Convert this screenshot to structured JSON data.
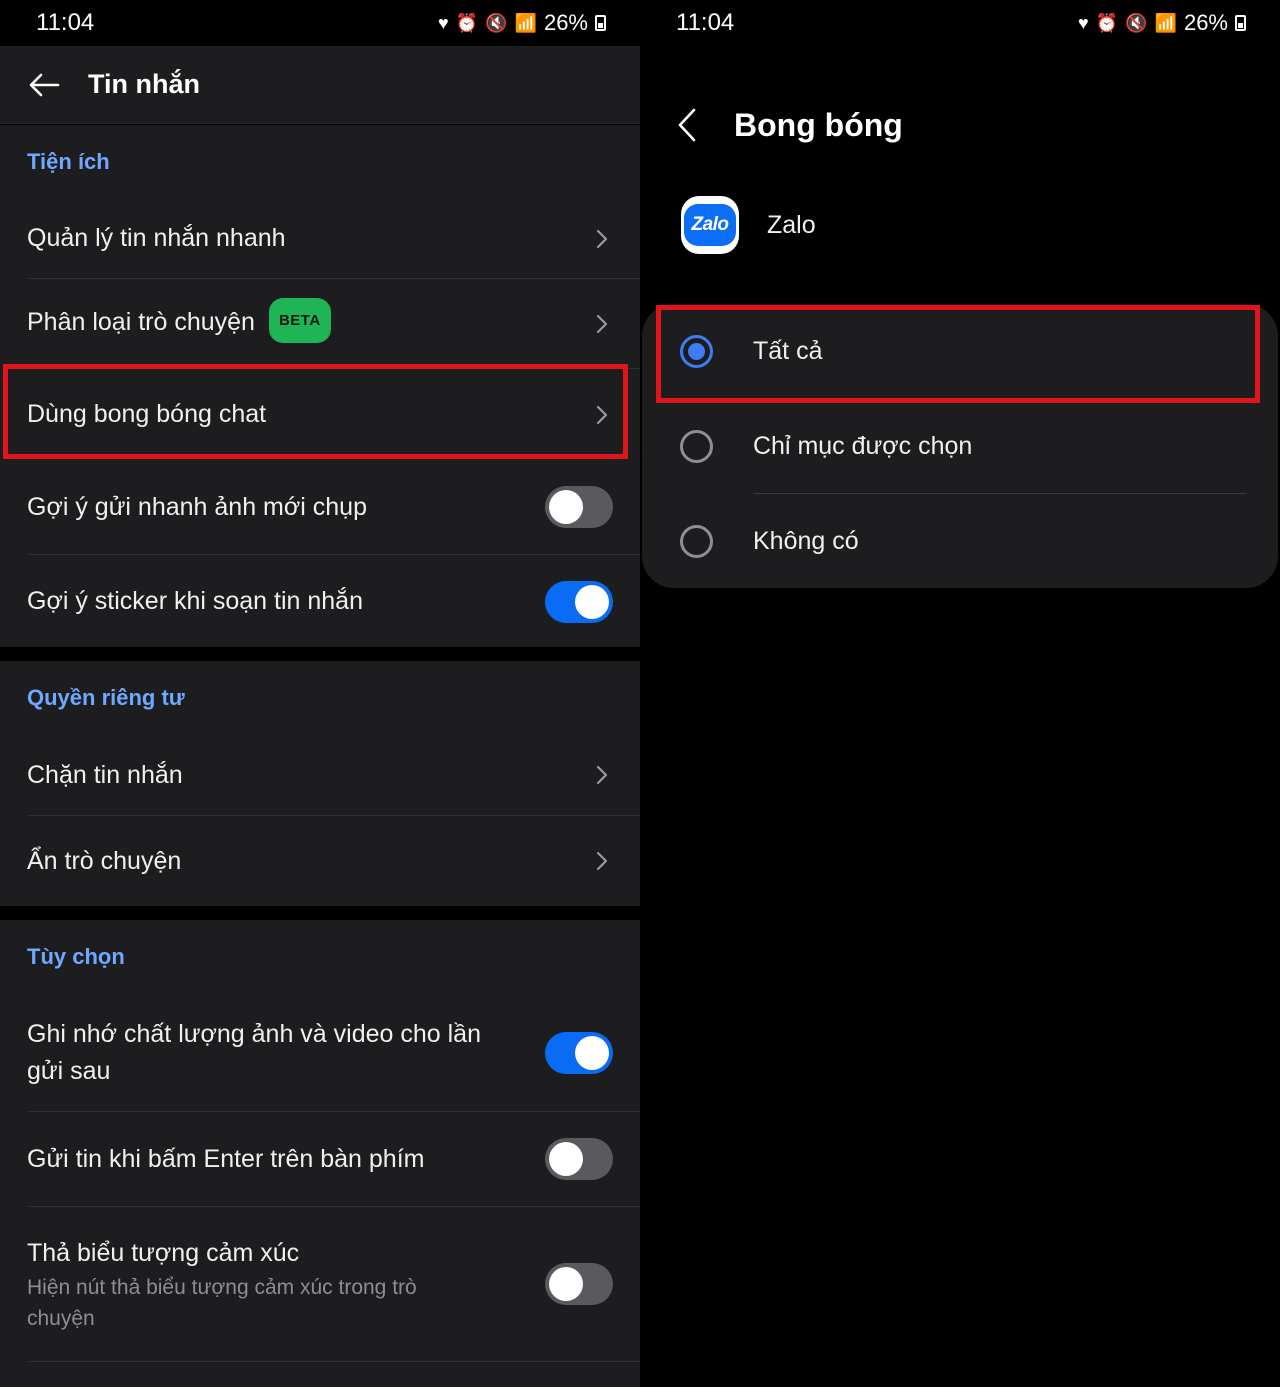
{
  "left": {
    "status": {
      "time": "11:04",
      "battery": "26%"
    },
    "header": {
      "title": "Tin nhắn"
    },
    "sections": {
      "utilities": {
        "title": "Tiện ích",
        "quick_messages": "Quản lý tin nhắn nhanh",
        "classify_chats": "Phân loại trò chuyện",
        "beta_badge": "BETA",
        "chat_bubbles": "Dùng bong bóng chat",
        "suggest_photo": "Gợi ý gửi nhanh ảnh mới chụp",
        "suggest_photo_on": false,
        "suggest_sticker": "Gợi ý sticker khi soạn tin nhắn",
        "suggest_sticker_on": true
      },
      "privacy": {
        "title": "Quyền riêng tư",
        "block_messages": "Chặn tin nhắn",
        "hide_chats": "Ẩn trò chuyện"
      },
      "options": {
        "title": "Tùy chọn",
        "remember_quality": "Ghi nhớ chất lượng ảnh và video cho lần gửi sau",
        "remember_quality_on": true,
        "enter_to_send": "Gửi tin khi bấm Enter trên bàn phím",
        "enter_to_send_on": false,
        "reactions": "Thả biểu tượng cảm xúc",
        "reactions_sub": "Hiện nút thả biểu tượng cảm xúc trong trò chuyện",
        "reactions_on": false
      }
    }
  },
  "right": {
    "status": {
      "time": "11:04",
      "battery": "26%"
    },
    "header": {
      "title": "Bong bóng"
    },
    "app": {
      "icon_text": "Zalo",
      "name": "Zalo"
    },
    "options": [
      {
        "label": "Tất cả",
        "selected": true
      },
      {
        "label": "Chỉ mục được chọn",
        "selected": false
      },
      {
        "label": "Không có",
        "selected": false
      }
    ]
  },
  "colors": {
    "accent": "#0a6bf5",
    "section_title": "#6ea8ff",
    "highlight": "#e0141b",
    "beta": "#1fb456"
  },
  "icons": [
    "back-arrow-icon",
    "chevron-right-icon",
    "heart-icon",
    "alarm-icon",
    "mute-icon",
    "wifi-icon",
    "signal-icon",
    "battery-icon"
  ]
}
